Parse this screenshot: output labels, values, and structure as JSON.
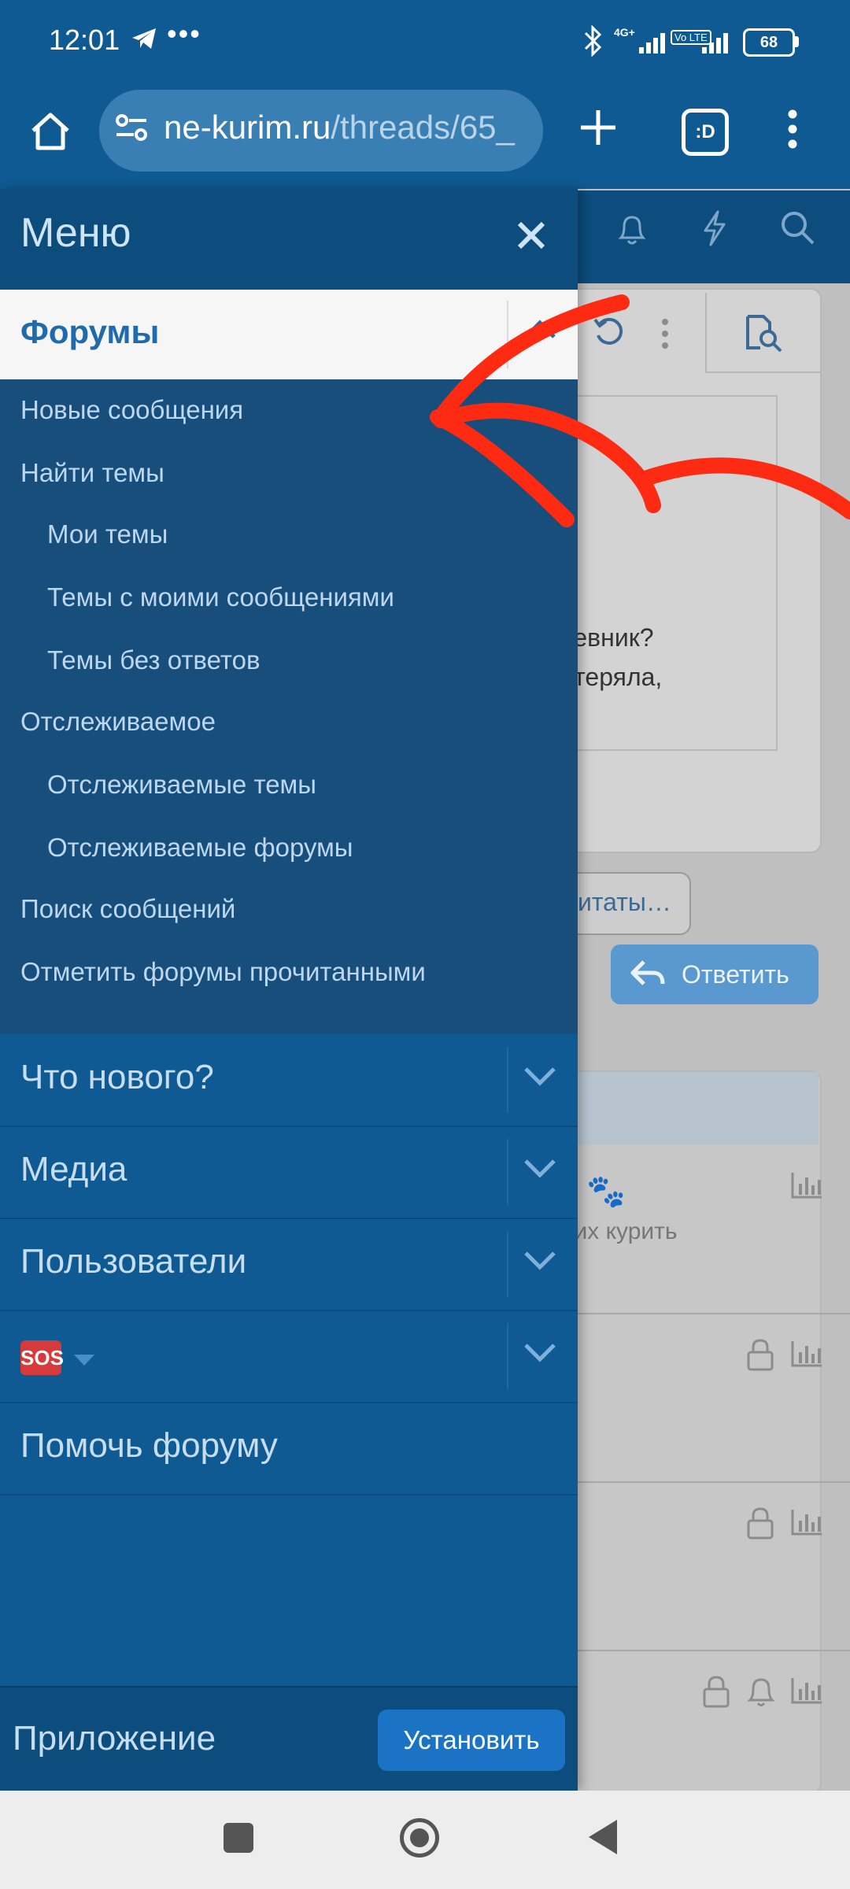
{
  "status_bar": {
    "time": "12:01",
    "dots": "•••",
    "network_1": "4G+",
    "network_2": "Vo LTE",
    "battery": "68",
    "icons": [
      "telegram-icon",
      "bluetooth-icon",
      "signal-icon",
      "battery-icon"
    ]
  },
  "browser": {
    "url_domain": "ne-kurim.ru",
    "url_path": "/threads/65_",
    "tabs_label": ":D",
    "icons": [
      "home-icon",
      "site-settings-icon",
      "new-tab-icon",
      "tabs-icon",
      "overflow-menu-icon"
    ]
  },
  "background_page": {
    "text_line_1": "дневник?",
    "text_line_2": "отеряла,",
    "quote_button": "итаты…",
    "reply_button": "Ответить",
    "forum_title_fragment": "ы 🐾",
    "forum_desc_fragment": "дих курить",
    "icons": [
      "bell-icon",
      "lightning-icon",
      "search-icon",
      "refresh-icon",
      "kebab-icon",
      "doc-search-icon",
      "reply-arrow-icon",
      "lock-icon",
      "stats-icon"
    ]
  },
  "drawer": {
    "title": "Меню",
    "close_icon": "close-icon",
    "forums_label": "Форумы",
    "submenu": [
      {
        "label": "Новые сообщения"
      },
      {
        "label": "Найти темы"
      },
      {
        "label": "Мои темы"
      },
      {
        "label": "Темы с моими сообщениями"
      },
      {
        "label": "Темы без ответов"
      },
      {
        "label": "Отслеживаемое"
      },
      {
        "label": "Отслеживаемые темы"
      },
      {
        "label": "Отслеживаемые форумы"
      },
      {
        "label": "Поиск сообщений"
      },
      {
        "label": "Отметить форумы прочитанными"
      }
    ],
    "sections": [
      {
        "label": "Что нового?"
      },
      {
        "label": "Медиа"
      },
      {
        "label": "Пользователи"
      },
      {
        "label": "🆘"
      },
      {
        "label": "Помочь форуму"
      }
    ],
    "sos_badge": "SOS",
    "app_label": "Приложение",
    "install_button": "Установить"
  },
  "annotation": {
    "color": "#ff2a12"
  },
  "nav_bar": {
    "icons": [
      "recents-icon",
      "home-nav-icon",
      "back-icon"
    ]
  }
}
